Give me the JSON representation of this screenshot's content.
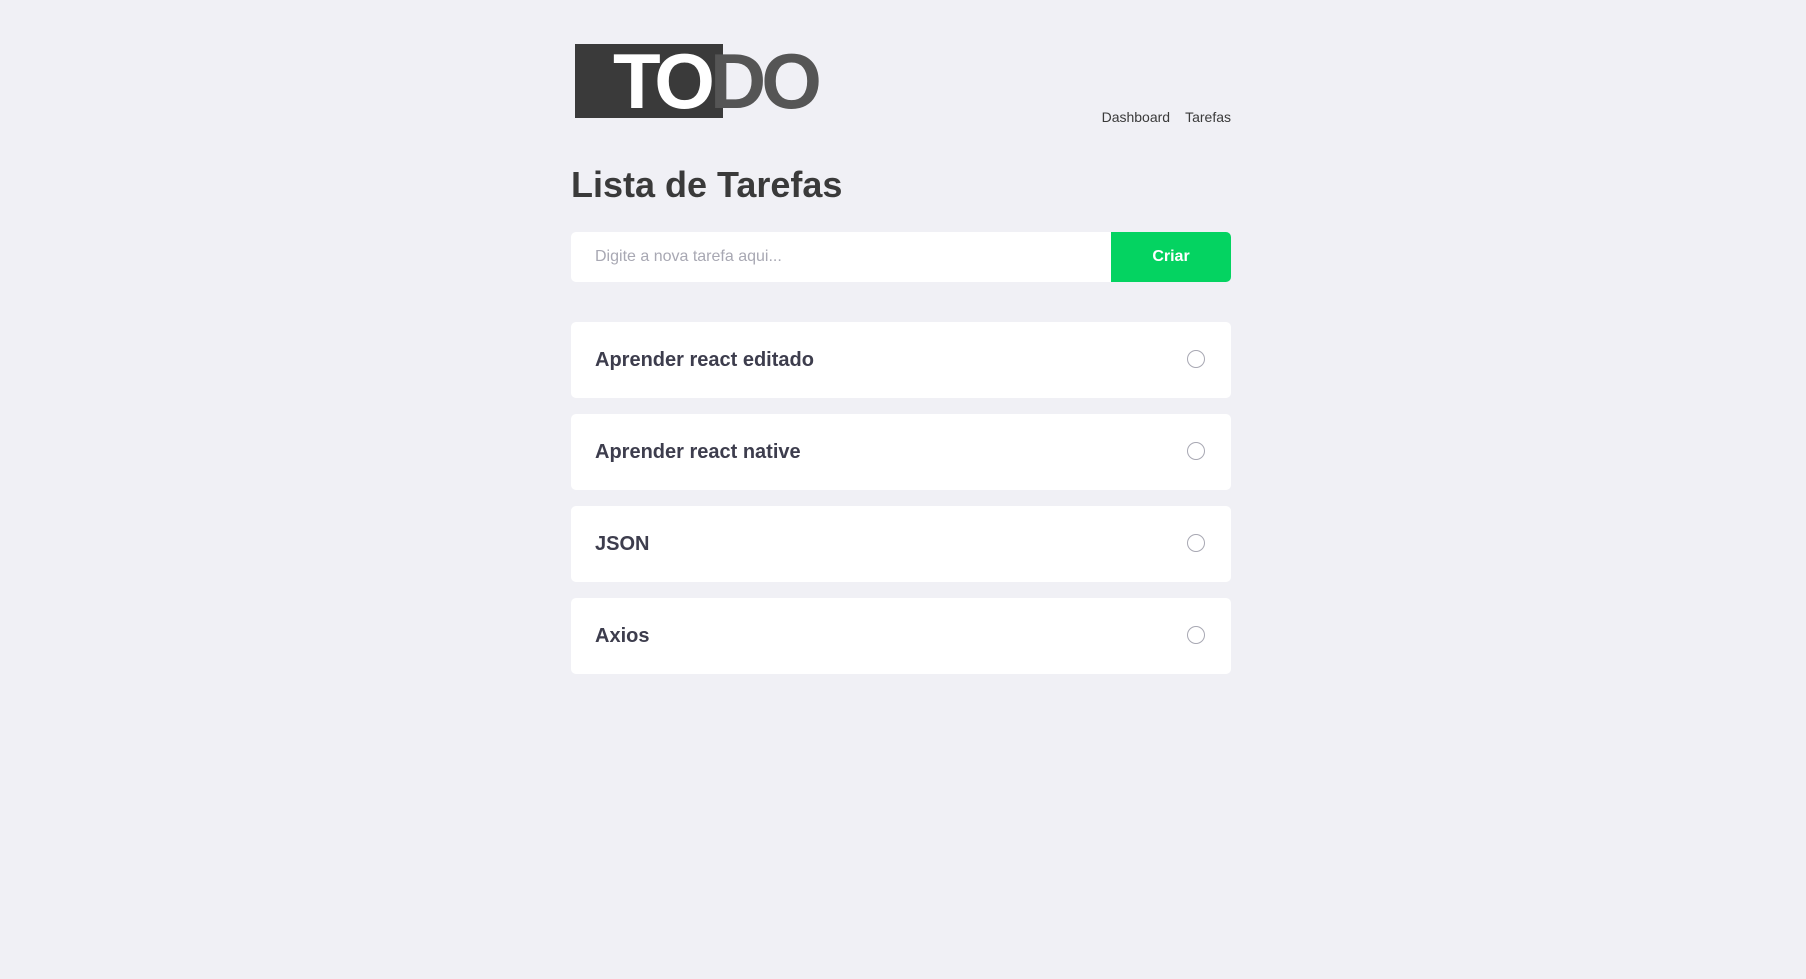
{
  "logo": {
    "text_light": "TO",
    "text_dark": "DO"
  },
  "nav": {
    "items": [
      {
        "label": "Dashboard"
      },
      {
        "label": "Tarefas"
      }
    ]
  },
  "page": {
    "title": "Lista de Tarefas"
  },
  "form": {
    "input_value": "",
    "input_placeholder": "Digite a nova tarefa aqui...",
    "submit_label": "Criar"
  },
  "tasks": [
    {
      "title": "Aprender react editado",
      "done": false
    },
    {
      "title": "Aprender react native",
      "done": false
    },
    {
      "title": "JSON",
      "done": false
    },
    {
      "title": "Axios",
      "done": false
    }
  ],
  "colors": {
    "background": "#f0f0f5",
    "accent": "#04d361",
    "logo_dark": "#3a3a3a",
    "text": "#3a3a3a"
  }
}
